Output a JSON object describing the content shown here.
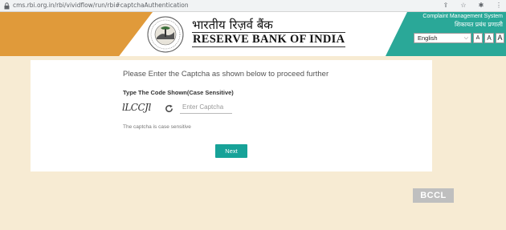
{
  "browser": {
    "url": "cms.rbi.org.in/rbi/vividflow/run/rbi#captchaAuthentication",
    "icons": [
      "share-icon",
      "star-icon",
      "extensions-icon",
      "menu-icon"
    ]
  },
  "header": {
    "bank_name_hindi": "भारतीय रिज़र्व बैंक",
    "bank_name_english": "RESERVE BANK OF INDIA",
    "cms_title_english": "Complaint Management System",
    "cms_title_hindi": "शिकायत प्रबंध प्रणाली",
    "language": "English",
    "font_size_buttons": [
      "A",
      "A",
      "A"
    ],
    "colors": {
      "orange": "#e09a3a",
      "teal": "#2aa898"
    }
  },
  "captcha": {
    "heading": "Please Enter the Captcha as shown below to proceed further",
    "label": "Type The Code Shown(Case Sensitive)",
    "code": "lLCCJl",
    "input_placeholder": "Enter Captcha",
    "input_value": "",
    "note": "The captcha is case sensitive",
    "next_label": "Next",
    "button_color": "#17a298"
  },
  "watermark": "BCCL"
}
